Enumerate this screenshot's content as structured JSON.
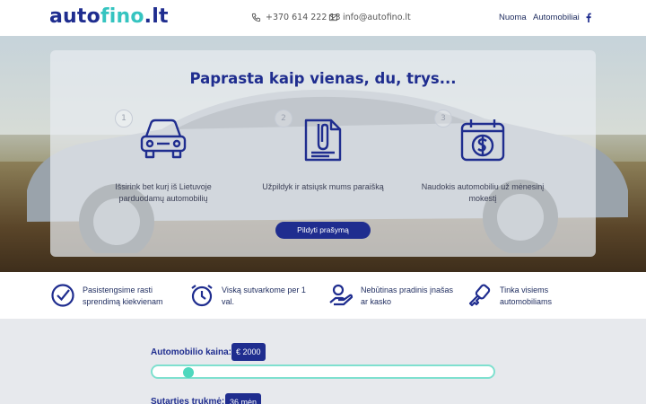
{
  "header": {
    "logo_part1": "auto",
    "logo_part2": "fino",
    "logo_part3": ".lt",
    "phone": "+370 614 222 13",
    "email": "info@autofino.lt",
    "nav": [
      "Nuoma",
      "Automobiliai"
    ],
    "social_icon": "facebook-icon"
  },
  "hero": {
    "title": "Paprasta kaip vienas, du, trys...",
    "steps": [
      {
        "num": "1",
        "icon": "car-icon",
        "text": "Išsirink bet kurį iš Lietuvoje parduodamų automobilių"
      },
      {
        "num": "2",
        "icon": "document-icon",
        "text": "Užpildyk ir atsiųsk mums paraišką"
      },
      {
        "num": "3",
        "icon": "calendar-money-icon",
        "text": "Naudokis automobiliu už mėnesinį mokestį"
      }
    ],
    "cta_label": "Pildyti prašymą"
  },
  "features": [
    {
      "icon": "check-circle-icon",
      "text": "Pasistengsime rasti sprendimą kiekvienam"
    },
    {
      "icon": "alarm-clock-icon",
      "text": "Viską sutvarkome per 1 val."
    },
    {
      "icon": "hand-money-icon",
      "text": "Nebūtinas pradinis įnašas ar kasko"
    },
    {
      "icon": "key-icon",
      "text": "Tinka visiems automobiliams"
    }
  ],
  "calculator": {
    "price_label": "Automobilio kaina:",
    "price_value": "€ 2000",
    "price_slider_fraction": 0.06,
    "term_label": "Sutarties trukmė:",
    "term_value": "36 mėn"
  },
  "colors": {
    "brand_dark": "#1f2d8f",
    "brand_accent": "#35c4c0",
    "slider": "#4ed8be"
  }
}
